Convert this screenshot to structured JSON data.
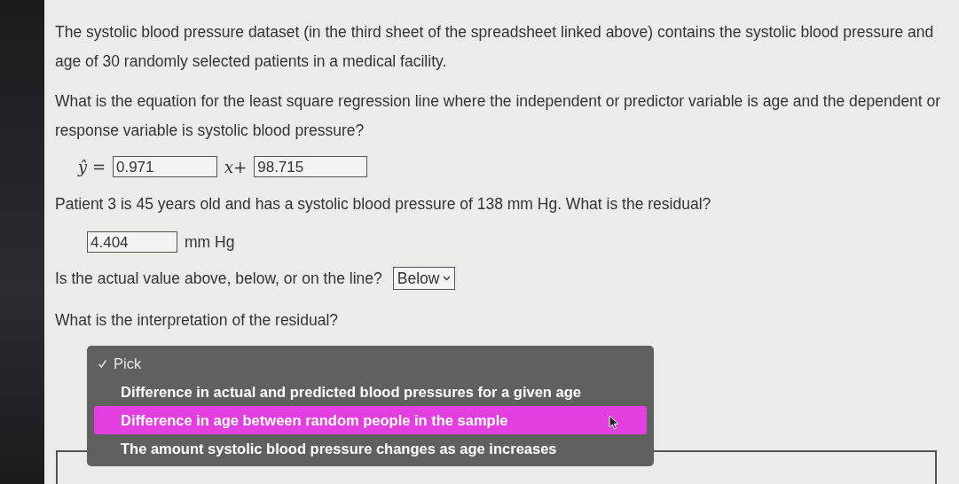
{
  "intro": "The systolic blood pressure dataset (in the third sheet of the spreadsheet linked above) contains the systolic blood pressure and age of 30 randomly selected patients in a medical facility.",
  "question_1": "What is the equation for the least square regression line where the independent or predictor variable is age and the dependent or response variable is systolic blood pressure?",
  "equation": {
    "lhs": "ŷ =",
    "slope": "0.971",
    "middle": "x+",
    "intercept": "98.715"
  },
  "question_2": "Patient 3 is 45 years old and has a systolic blood pressure of 138 mm Hg. What is the residual?",
  "residual": {
    "value": "4.404",
    "unit": "mm Hg"
  },
  "question_3": {
    "text": "Is the actual value above, below, or on the line?",
    "answer": "Below"
  },
  "question_4": "What is the interpretation of the residual?",
  "menu": [
    {
      "label": "Pick",
      "checked": true,
      "selected": false
    },
    {
      "label": "Difference in actual and predicted blood pressures for a given age",
      "checked": false,
      "selected": false
    },
    {
      "label": "Difference in age between random people in the sample",
      "checked": false,
      "selected": true
    },
    {
      "label": "The amount systolic blood pressure changes as age increases",
      "checked": false,
      "selected": false
    }
  ]
}
